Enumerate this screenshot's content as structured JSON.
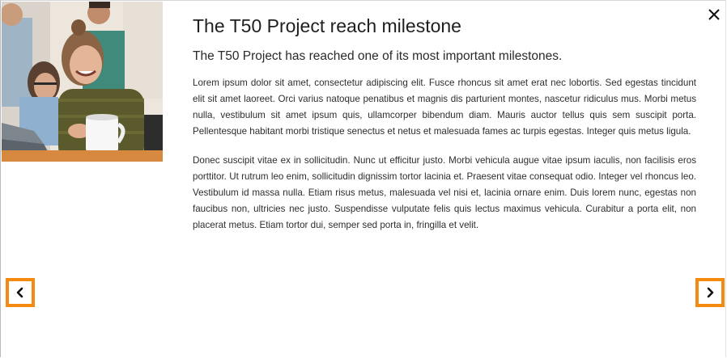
{
  "article": {
    "title": "The T50 Project reach milestone",
    "subtitle": "The T50 Project has reached one of its most important milestones.",
    "paragraphs": [
      "Lorem ipsum dolor sit amet, consectetur adipiscing elit. Fusce rhoncus sit amet erat nec lobortis. Sed egestas tincidunt elit sit amet laoreet. Orci varius natoque penatibus et magnis dis parturient montes, nascetur ridiculus mus. Morbi metus nulla, vestibulum sit amet ipsum quis, ullamcorper bibendum diam. Mauris auctor tellus quis sem suscipit porta. Pellentesque habitant morbi tristique senectus et netus et malesuada fames ac turpis egestas. Integer quis metus ligula.",
      "Donec suscipit vitae ex in sollicitudin. Nunc ut efficitur justo. Morbi vehicula augue vitae ipsum iaculis, non facilisis eros porttitor. Ut rutrum leo enim, sollicitudin dignissim tortor lacinia et. Praesent vitae consequat odio. Integer vel rhoncus leo. Vestibulum id massa nulla. Etiam risus metus, malesuada vel nisi et, lacinia ornare enim. Duis lorem nunc, egestas non faucibus non, ultricies nec justo. Suspendisse vulputate felis quis lectus maximus vehicula. Curabitur a porta elit, non placerat metus. Etiam tortor dui, semper sed porta in, fringilla et velit."
    ]
  },
  "icons": {
    "close": "close-icon",
    "prev": "chevron-left-icon",
    "next": "chevron-right-icon"
  },
  "colors": {
    "nav_border": "#f48a10"
  }
}
